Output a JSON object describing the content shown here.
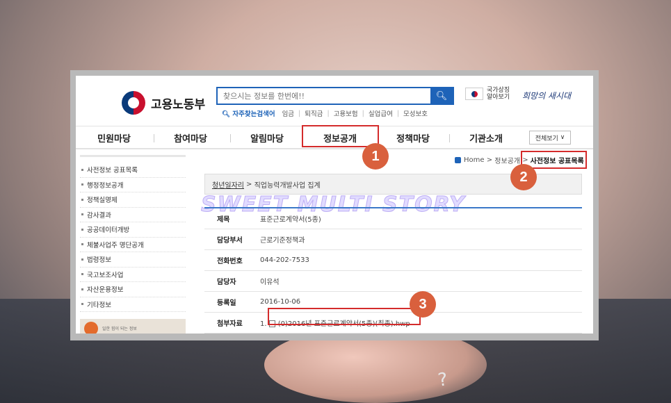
{
  "header": {
    "logo_text": "고용노동부",
    "search_placeholder": "찾으시는 정보를 한번에!!",
    "search_icon": "search-icon",
    "quick_links": [
      "임금",
      "퇴직금",
      "고용보험",
      "실업급여",
      "모성보호"
    ],
    "hot_search_label": "자주찾는검색어",
    "national_symbol": "국가상징 알아보기",
    "slogan": "희망의 새시대"
  },
  "gnb": {
    "items": [
      "민원마당",
      "참여마당",
      "알림마당",
      "정보공개",
      "정책마당",
      "기관소개"
    ],
    "view_all": "전체보기"
  },
  "sidebar": {
    "items": [
      "사전정보 공표목록",
      "행정정보공개",
      "정책실명제",
      "감사결과",
      "공공데이터개방",
      "체불사업주 명단공개",
      "법령정보",
      "국고보조사업",
      "자산운용정보",
      "기타정보"
    ],
    "banner_text": "일한 힘이 되는 정보"
  },
  "breadcrumb": {
    "home": "Home",
    "parent": "정보공개",
    "current": "사전정보 공표목록"
  },
  "path_bar": {
    "link": "청년일자리",
    "current": "직업능력개발사업 집계"
  },
  "watermark": "SWEET MULTI STORY",
  "info": {
    "rows": [
      {
        "label": "제목",
        "value": "표준근로계약서(5종)"
      },
      {
        "label": "담당부서",
        "value": "근로기준정책과"
      },
      {
        "label": "전화번호",
        "value": "044-202-7533"
      },
      {
        "label": "담당자",
        "value": "이유석"
      },
      {
        "label": "등록일",
        "value": "2016-10-06"
      },
      {
        "label": "첨부자료",
        "value": "(0)2016년 표준근로계약서(5종)(최종).hwp",
        "prefix": "1."
      }
    ]
  },
  "annotations": {
    "badges": [
      "1",
      "2",
      "3"
    ],
    "highlight_color": "#d42b2b",
    "badge_color": "#d9603d"
  },
  "background": {
    "key_glyph": "?"
  }
}
